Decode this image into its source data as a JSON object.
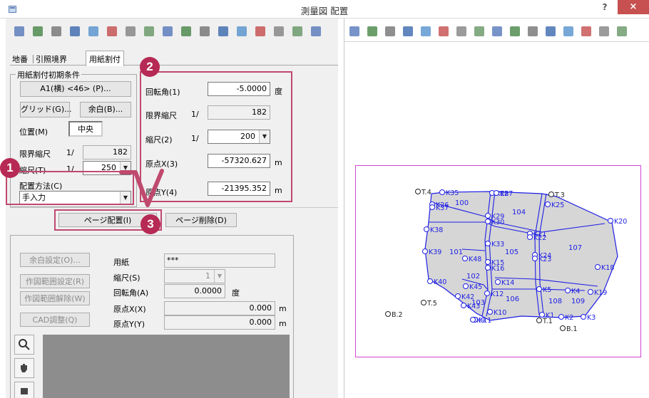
{
  "window": {
    "title": "測量図 配置",
    "help": "?",
    "close": "×"
  },
  "toolbar_left": [
    {
      "icon": "arrow-up-icon"
    },
    {
      "icon": "arrow-down-icon"
    },
    {
      "icon": "list-icon"
    },
    {
      "icon": "binoculars-icon"
    },
    {
      "icon": "table-icon"
    },
    {
      "icon": "table-add-icon"
    },
    {
      "icon": "table-remove-icon"
    },
    {
      "icon": "grid-icon"
    },
    {
      "icon": "layout-icon"
    },
    {
      "icon": "circle-icon"
    },
    {
      "icon": "circle-fill-icon"
    },
    {
      "icon": "sheet-icon"
    },
    {
      "icon": "point-icon"
    },
    {
      "icon": "multipoint-icon"
    },
    {
      "icon": "multipoint-remove-icon"
    },
    {
      "icon": "tool-icon"
    },
    {
      "icon": "tool-more-icon"
    }
  ],
  "toolbar_right": [
    {
      "icon": "zoom-icon"
    },
    {
      "icon": "zoom-in-icon"
    },
    {
      "icon": "zoom-out-icon"
    },
    {
      "icon": "zoom-window-icon"
    },
    {
      "icon": "pan-icon"
    },
    {
      "icon": "fit-icon"
    },
    {
      "icon": "region-icon"
    },
    {
      "icon": "search-icon"
    },
    {
      "icon": "bulb-icon"
    },
    {
      "icon": "print-icon"
    },
    {
      "icon": "line-icon"
    },
    {
      "icon": "angle-icon"
    },
    {
      "icon": "angle2-icon"
    },
    {
      "icon": "save-icon"
    },
    {
      "icon": "layout-icon"
    },
    {
      "icon": "layout2-icon"
    }
  ],
  "tabs": {
    "lot": "地番",
    "reference": "引照境界",
    "paper": "用紙割付"
  },
  "initial": {
    "group_title": "用紙割付初期条件",
    "paper_button": "A1(横) <46> (P)...",
    "grid_button": "グリッド(G)...",
    "margin_button": "余白(B)...",
    "position_label": "位置(M)",
    "position_value": "中央",
    "limit_scale_label": "限界縮尺",
    "limit_scale_prefix": "1/",
    "limit_scale_value": "182",
    "scale_label": "縮尺(T)",
    "scale_prefix": "1/",
    "scale_value": "250",
    "method_label": "配置方法(C)",
    "method_value": "手入力"
  },
  "params": {
    "rotation_label": "回転角(1)",
    "rotation_value": "-5.0000",
    "rotation_unit": "度",
    "limit_scale_label": "限界縮尺",
    "limit_scale_prefix": "1/",
    "limit_scale_value": "182",
    "scale_label": "縮尺(2)",
    "scale_prefix": "1/",
    "scale_value": "200",
    "originx_label": "原点X(3)",
    "originx_value": "-57320.627",
    "originx_unit": "m",
    "originy_label": "原点Y(4)",
    "originy_value": "-21395.352",
    "originy_unit": "m"
  },
  "page_buttons": {
    "place": "ページ配置(I)",
    "delete": "ページ削除(D)"
  },
  "page_settings": {
    "margin_button": "余白設定(O)...",
    "range_set_button": "作図範囲設定(R)",
    "range_clear_button": "作図範囲解除(W)",
    "cad_button": "CAD調整(Q)",
    "paper_label": "用紙",
    "paper_value": "***",
    "scale_label": "縮尺(S)",
    "scale_value": "1",
    "rotation_label": "回転角(A)",
    "rotation_value": "0.0000",
    "rotation_unit": "度",
    "originx_label": "原点X(X)",
    "originx_value": "0.000",
    "originx_unit": "m",
    "originy_label": "原点Y(Y)",
    "originy_value": "0.000",
    "originy_unit": "m"
  },
  "callouts": {
    "one": "1",
    "two": "2",
    "three": "3"
  },
  "colors": {
    "accent": "#c0496e",
    "badge": "#b62a55",
    "drawing": "#2020e0",
    "page_frame": "#d147d1"
  },
  "map": {
    "points": [
      {
        "name": "T.4",
        "color": "black"
      },
      {
        "name": "T.3",
        "color": "black"
      },
      {
        "name": "T.5",
        "color": "black"
      },
      {
        "name": "T.1",
        "color": "black"
      },
      {
        "name": "B.2",
        "color": "black"
      },
      {
        "name": "B.1",
        "color": "black"
      },
      {
        "name": "K35"
      },
      {
        "name": "K28"
      },
      {
        "name": "K27"
      },
      {
        "name": "K26"
      },
      {
        "name": "K37"
      },
      {
        "name": "K25"
      },
      {
        "name": "K29"
      },
      {
        "name": "K30"
      },
      {
        "name": "K20"
      },
      {
        "name": "K38"
      },
      {
        "name": "K21"
      },
      {
        "name": "K22"
      },
      {
        "name": "K33"
      },
      {
        "name": "K39"
      },
      {
        "name": "K48"
      },
      {
        "name": "K15"
      },
      {
        "name": "K16"
      },
      {
        "name": "K24"
      },
      {
        "name": "K23"
      },
      {
        "name": "K18"
      },
      {
        "name": "K40"
      },
      {
        "name": "K45"
      },
      {
        "name": "K14"
      },
      {
        "name": "K5"
      },
      {
        "name": "K4"
      },
      {
        "name": "K19"
      },
      {
        "name": "K12"
      },
      {
        "name": "K42"
      },
      {
        "name": "K43"
      },
      {
        "name": "K10"
      },
      {
        "name": "K11"
      },
      {
        "name": "K9"
      },
      {
        "name": "K1"
      },
      {
        "name": "K2"
      },
      {
        "name": "K3"
      }
    ],
    "parcels": [
      "100",
      "104",
      "105",
      "107",
      "101",
      "102",
      "103",
      "106",
      "108",
      "109"
    ]
  }
}
